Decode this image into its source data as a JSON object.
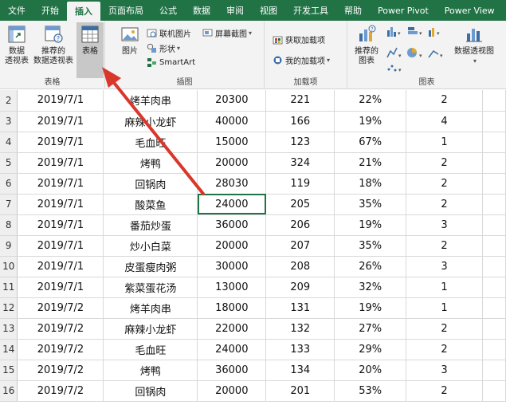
{
  "ribbon_tabs": [
    "文件",
    "开始",
    "插入",
    "页面布局",
    "公式",
    "数据",
    "审阅",
    "视图",
    "开发工具",
    "帮助",
    "Power Pivot",
    "Power View"
  ],
  "active_tab_index": 2,
  "groups": {
    "tables": {
      "label": "表格",
      "pivot_label_1": "数据",
      "pivot_label_2": "透视表",
      "rec_pivot_label_1": "推荐的",
      "rec_pivot_label_2": "数据透视表",
      "table_label": "表格"
    },
    "illustrations": {
      "label": "插图",
      "picture_label": "图片",
      "online_picture": "联机图片",
      "shapes": "形状",
      "smartart": "SmartArt",
      "screenshot": "屏幕截图"
    },
    "addins": {
      "label": "加载项",
      "get_addins": "获取加载项",
      "my_addins": "我的加载项"
    },
    "charts": {
      "label": "图表",
      "rec_charts_1": "推荐的",
      "rec_charts_2": "图表",
      "pivot_chart": "数据透视图"
    }
  },
  "colors": {
    "accent": "#217346",
    "arrow": "#d9372b"
  },
  "rows": [
    {
      "n": "2",
      "date": "2019/7/1",
      "dish": "烤羊肉串",
      "amount": "20300",
      "qty": "221",
      "pct": "22%",
      "rank": "2"
    },
    {
      "n": "3",
      "date": "2019/7/1",
      "dish": "麻辣小龙虾",
      "amount": "40000",
      "qty": "166",
      "pct": "19%",
      "rank": "4"
    },
    {
      "n": "4",
      "date": "2019/7/1",
      "dish": "毛血旺",
      "amount": "15000",
      "qty": "123",
      "pct": "67%",
      "rank": "1"
    },
    {
      "n": "5",
      "date": "2019/7/1",
      "dish": "烤鸭",
      "amount": "20000",
      "qty": "324",
      "pct": "21%",
      "rank": "2"
    },
    {
      "n": "6",
      "date": "2019/7/1",
      "dish": "回锅肉",
      "amount": "28030",
      "qty": "119",
      "pct": "18%",
      "rank": "2"
    },
    {
      "n": "7",
      "date": "2019/7/1",
      "dish": "酸菜鱼",
      "amount": "24000",
      "qty": "205",
      "pct": "35%",
      "rank": "2"
    },
    {
      "n": "8",
      "date": "2019/7/1",
      "dish": "番茄炒蛋",
      "amount": "36000",
      "qty": "206",
      "pct": "19%",
      "rank": "3"
    },
    {
      "n": "9",
      "date": "2019/7/1",
      "dish": "炒小白菜",
      "amount": "20000",
      "qty": "207",
      "pct": "35%",
      "rank": "2"
    },
    {
      "n": "10",
      "date": "2019/7/1",
      "dish": "皮蛋瘦肉粥",
      "amount": "30000",
      "qty": "208",
      "pct": "26%",
      "rank": "3"
    },
    {
      "n": "11",
      "date": "2019/7/1",
      "dish": "紫菜蛋花汤",
      "amount": "13000",
      "qty": "209",
      "pct": "32%",
      "rank": "1"
    },
    {
      "n": "12",
      "date": "2019/7/2",
      "dish": "烤羊肉串",
      "amount": "18000",
      "qty": "131",
      "pct": "19%",
      "rank": "1"
    },
    {
      "n": "13",
      "date": "2019/7/2",
      "dish": "麻辣小龙虾",
      "amount": "22000",
      "qty": "132",
      "pct": "27%",
      "rank": "2"
    },
    {
      "n": "14",
      "date": "2019/7/2",
      "dish": "毛血旺",
      "amount": "24000",
      "qty": "133",
      "pct": "29%",
      "rank": "2"
    },
    {
      "n": "15",
      "date": "2019/7/2",
      "dish": "烤鸭",
      "amount": "36000",
      "qty": "134",
      "pct": "20%",
      "rank": "3"
    },
    {
      "n": "16",
      "date": "2019/7/2",
      "dish": "回锅肉",
      "amount": "20000",
      "qty": "201",
      "pct": "53%",
      "rank": "2"
    }
  ],
  "selected_row_index": 5
}
